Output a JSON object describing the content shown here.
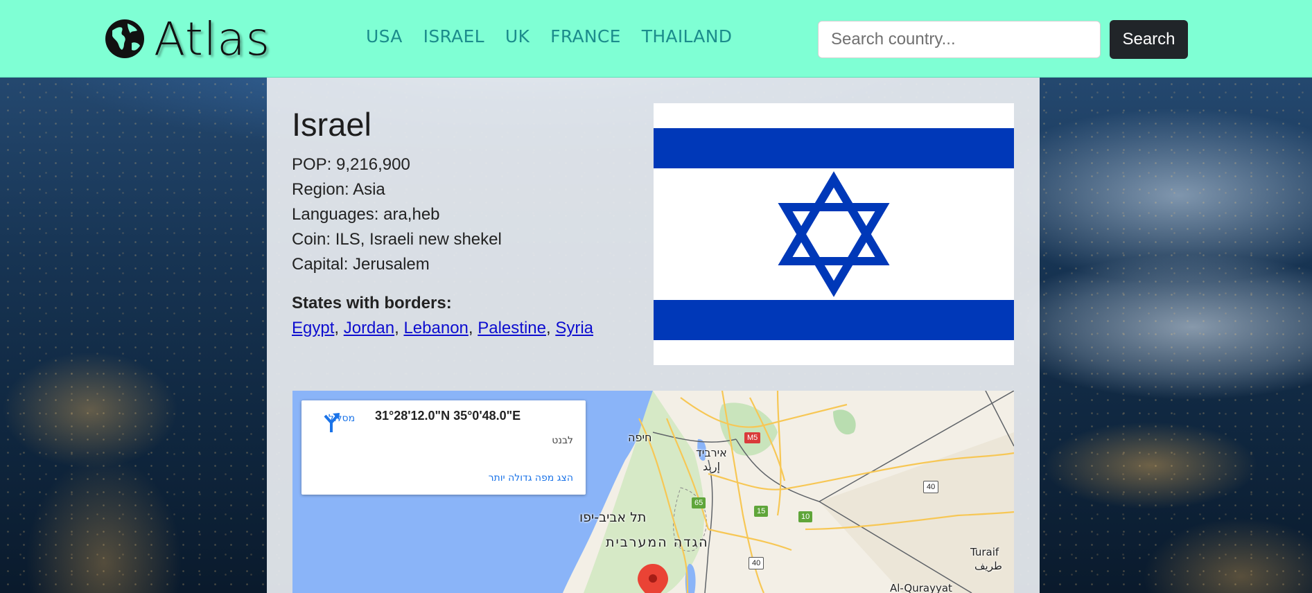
{
  "header": {
    "logo_text": "Atlas",
    "nav": [
      "USA",
      "ISRAEL",
      "UK",
      "FRANCE",
      "THAILAND"
    ],
    "search_placeholder": "Search country...",
    "search_button": "Search",
    "colors": {
      "background": "#7fffd4",
      "link": "#1c8c8c",
      "button": "#212529"
    }
  },
  "country": {
    "name": "Israel",
    "info": [
      "POP: 9,216,900",
      "Region: Asia",
      "Languages: ara,heb",
      "Coin: ILS, Israeli new shekel",
      "Capital: Jerusalem"
    ],
    "borders_title": "States with borders:",
    "borders": [
      "Egypt",
      "Jordan",
      "Lebanon",
      "Palestine",
      "Syria"
    ],
    "flag": {
      "name": "israel-flag",
      "colors": {
        "blue": "#0038b8",
        "white": "#ffffff"
      }
    }
  },
  "map": {
    "coordinates": "31°28'12.0\"N 35°0'48.0\"E",
    "place": "לבנט",
    "route_label": "מסלול",
    "larger_map_link": "הצג מפה גדולה יותר",
    "labels": [
      "חיפה",
      "אירביד",
      "إربد",
      "תל אביב-יפו",
      "הגדה המערבית",
      "Turaif",
      "طريف",
      "Al-Qurayyat"
    ],
    "road_numbers": [
      "M5",
      "65",
      "15",
      "10",
      "40",
      "40"
    ],
    "colors": {
      "sea": "#8ab4f8",
      "land": "#f3efe6",
      "road": "#f7c755",
      "border": "#5f6368",
      "green": "#cfe8c0"
    }
  }
}
